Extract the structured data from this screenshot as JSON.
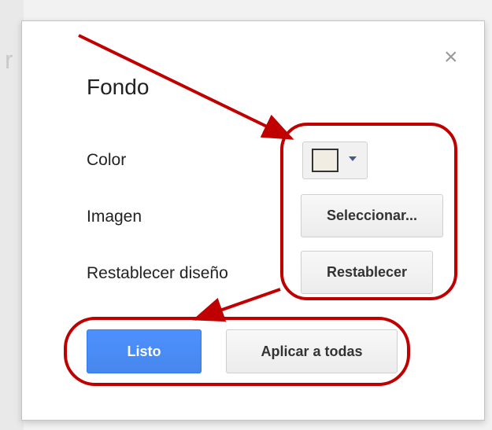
{
  "background": {
    "glyph": "r"
  },
  "dialog": {
    "title": "Fondo",
    "close_icon": "close-icon",
    "close_glyph": "×",
    "rows": {
      "color_label": "Color",
      "image_label": "Imagen",
      "reset_label": "Restablecer diseño"
    },
    "color": {
      "selected_value": "#f1ede3"
    },
    "select_image_button": "Seleccionar...",
    "reset_button": "Restablecer",
    "done_button": "Listo",
    "apply_all_button": "Aplicar a todas"
  },
  "colors": {
    "primary_button": "#4d90fe",
    "annotation_red": "#c00000",
    "swatch": "#f1ede3"
  }
}
